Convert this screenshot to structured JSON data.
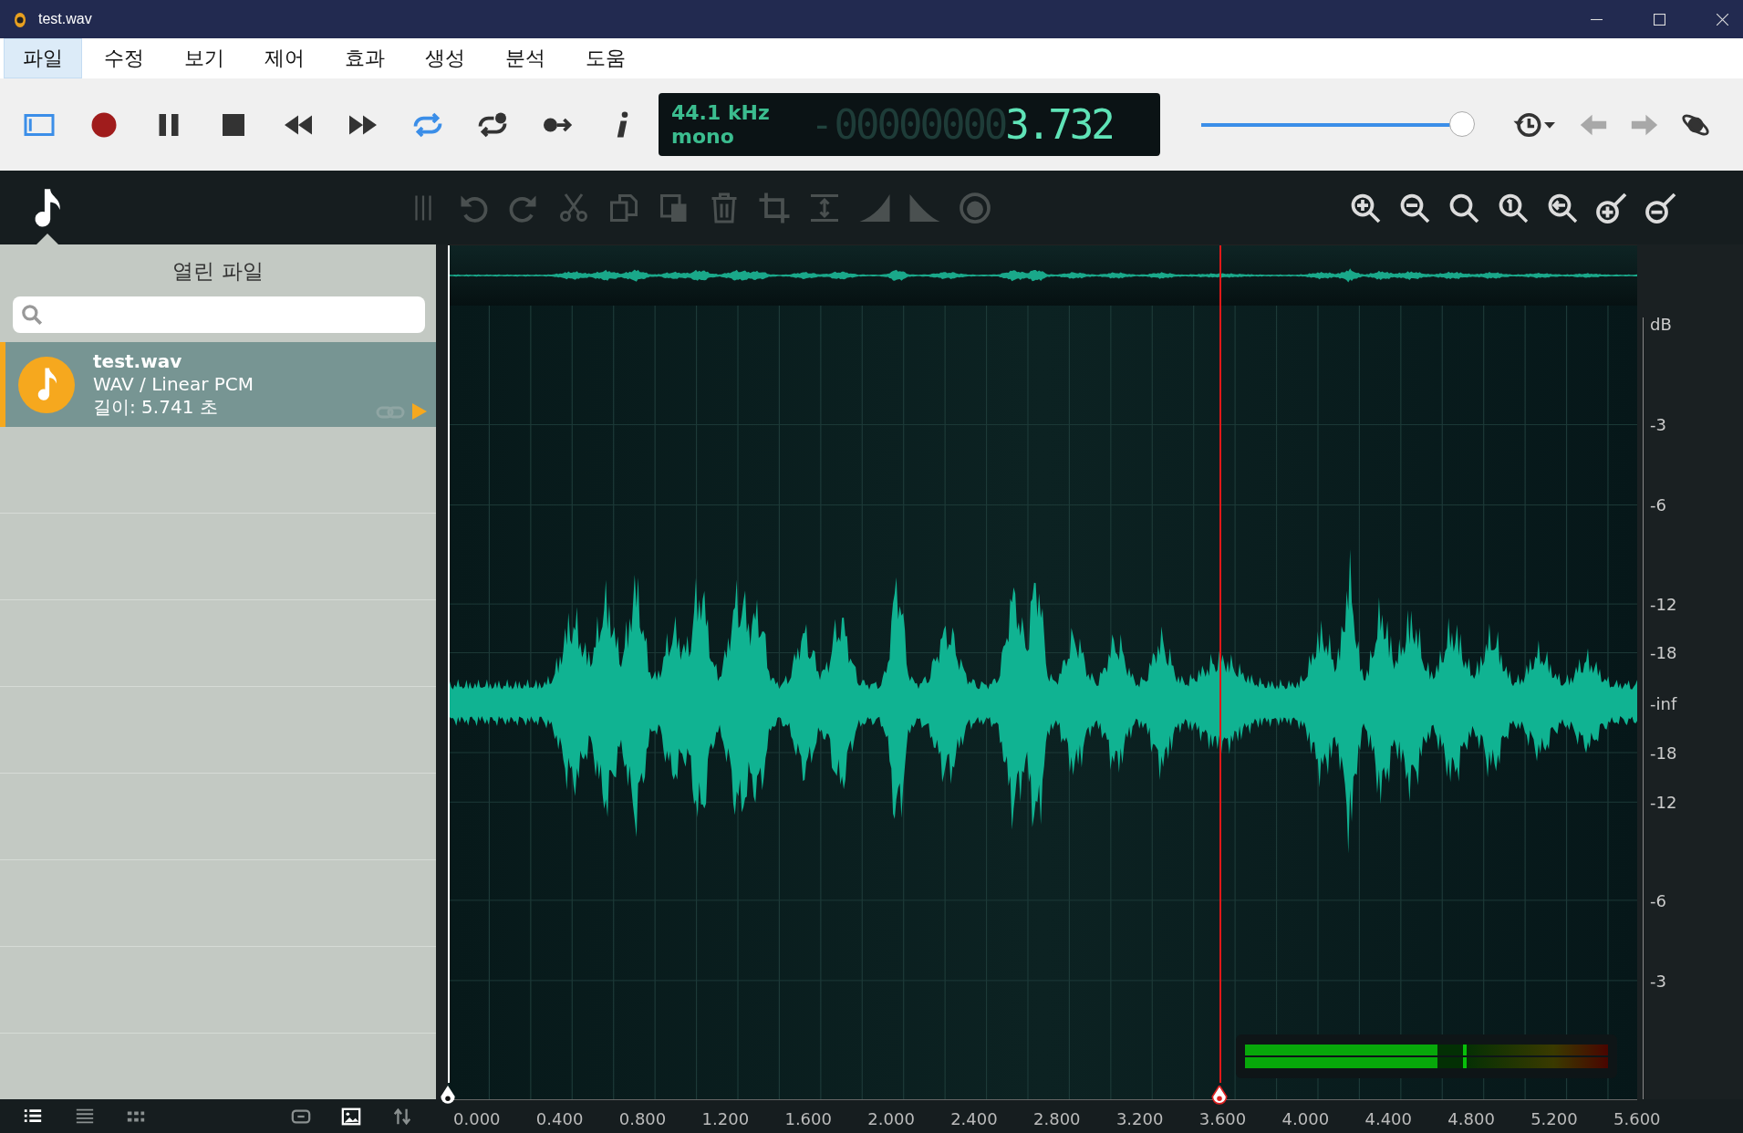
{
  "window": {
    "title": "test.wav"
  },
  "menu": [
    {
      "label": "파일",
      "selected": true
    },
    {
      "label": "수정",
      "selected": false
    },
    {
      "label": "보기",
      "selected": false
    },
    {
      "label": "제어",
      "selected": false
    },
    {
      "label": "효과",
      "selected": false
    },
    {
      "label": "생성",
      "selected": false
    },
    {
      "label": "분석",
      "selected": false
    },
    {
      "label": "도움",
      "selected": false
    }
  ],
  "transport": [
    {
      "kind": "sidebar",
      "on": true
    },
    {
      "kind": "record",
      "on": false
    },
    {
      "kind": "pause",
      "on": false
    },
    {
      "kind": "stop",
      "on": false
    },
    {
      "kind": "rewind",
      "on": false
    },
    {
      "kind": "forward",
      "on": false
    },
    {
      "kind": "loop",
      "on": true
    },
    {
      "kind": "loop-dot",
      "on": false
    },
    {
      "kind": "follow",
      "on": false
    },
    {
      "kind": "info",
      "on": false
    }
  ],
  "time_display": {
    "sample_rate": "44.1 kHz",
    "channels": "mono",
    "sign": "-",
    "dim_digits": "00000000",
    "digits": "3.732"
  },
  "volume": {
    "level": 1.0
  },
  "nav": [
    {
      "kind": "history",
      "disabled": false
    },
    {
      "kind": "caret",
      "disabled": false
    },
    {
      "kind": "back",
      "disabled": true
    },
    {
      "kind": "forward",
      "disabled": true
    },
    {
      "kind": "planet",
      "disabled": false
    }
  ],
  "edit_tools": [
    {
      "kind": "grip",
      "disabled": true
    },
    {
      "kind": "undo",
      "disabled": true
    },
    {
      "kind": "redo",
      "disabled": true
    },
    {
      "kind": "cut",
      "disabled": true
    },
    {
      "kind": "copy",
      "disabled": true
    },
    {
      "kind": "paste",
      "disabled": true
    },
    {
      "kind": "delete",
      "disabled": true
    },
    {
      "kind": "crop",
      "disabled": true
    },
    {
      "kind": "normalize",
      "disabled": true
    },
    {
      "kind": "fade-in",
      "disabled": true
    },
    {
      "kind": "fade-out",
      "disabled": true
    },
    {
      "kind": "dial",
      "disabled": true
    }
  ],
  "zoom_tools": [
    {
      "kind": "zoom-in",
      "disabled": false
    },
    {
      "kind": "zoom-out",
      "disabled": false
    },
    {
      "kind": "zoom",
      "disabled": false
    },
    {
      "kind": "zoom-one",
      "disabled": false
    },
    {
      "kind": "zoom-back",
      "disabled": false
    },
    {
      "kind": "v-zoom-in",
      "disabled": false
    },
    {
      "kind": "v-zoom-out",
      "disabled": false
    }
  ],
  "sidebar": {
    "title": "열린 파일",
    "files": [
      {
        "name": "test.wav",
        "format": "WAV / Linear PCM",
        "duration": "길이: 5.741 초",
        "selected": true
      }
    ]
  },
  "bottom_bar": [
    {
      "kind": "list",
      "selected": true
    },
    {
      "kind": "lines",
      "selected": false
    },
    {
      "kind": "grid",
      "selected": false
    },
    {
      "kind": "link",
      "selected": false
    },
    {
      "kind": "image",
      "selected": true
    },
    {
      "kind": "sort",
      "selected": false
    }
  ],
  "db_scale": [
    "dB",
    "-3",
    "-6",
    "-12",
    "-18",
    "-inf",
    "-18",
    "-12",
    "-6",
    "-3"
  ],
  "time_ruler": [
    "0.000",
    "0.400",
    "0.800",
    "1.200",
    "1.600",
    "2.000",
    "2.400",
    "2.800",
    "3.200",
    "3.600",
    "4.000",
    "4.400",
    "4.800",
    "5.200",
    "5.600"
  ],
  "playhead": {
    "level": 0.649
  },
  "meter": [
    {
      "level": 0.53,
      "peak": {
        "level": 0.6
      }
    },
    {
      "level": 0.53,
      "peak": {
        "level": 0.6
      }
    }
  ]
}
